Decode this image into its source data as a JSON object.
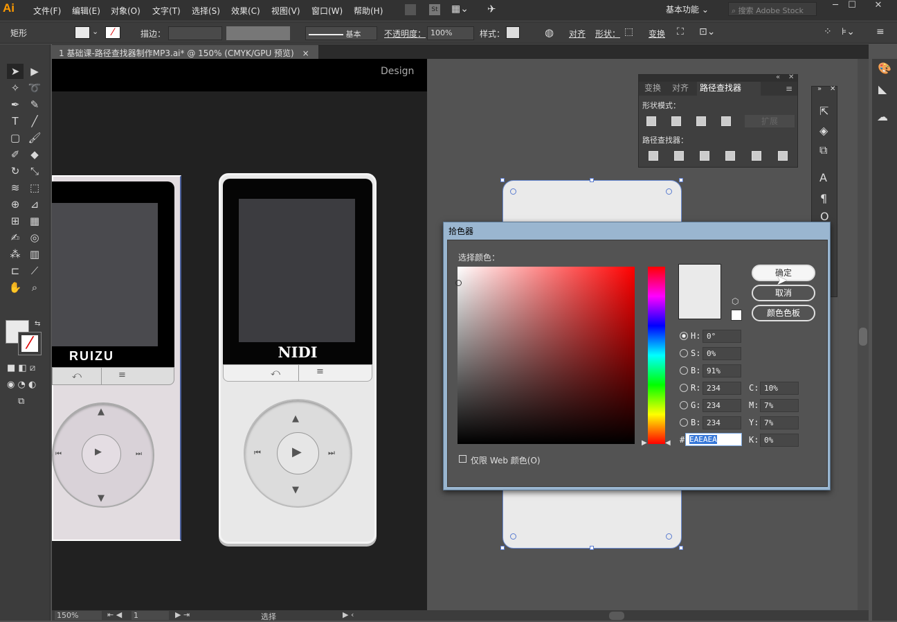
{
  "app": {
    "logo": "Ai",
    "workspace": "基本功能 ⌄",
    "stock_search": "搜索 Adobe Stock"
  },
  "menu": [
    "文件(F)",
    "编辑(E)",
    "对象(O)",
    "文字(T)",
    "选择(S)",
    "效果(C)",
    "视图(V)",
    "窗口(W)",
    "帮助(H)"
  ],
  "control": {
    "shape": "矩形",
    "stroke_label": "描边：",
    "style_preset": "基本",
    "opacity_label": "不透明度：",
    "opacity_value": "100%",
    "style_label": "样式：",
    "align": "对齐",
    "shape_label": "形状：",
    "transform": "变换"
  },
  "document": {
    "tab": "1 基础课-路径查找器制作MP3.ai* @ 150% (CMYK/GPU 预览)",
    "close": "×"
  },
  "artboard": {
    "design_text": "Design",
    "player1_brand": "RUIZU",
    "player2_brand": "NIDI"
  },
  "pathfinder": {
    "tabs": [
      "变换",
      "对齐",
      "路径查找器"
    ],
    "shape_modes": "形状模式：",
    "pathfinders": "路径查找器："
  },
  "status": {
    "zoom": "150%",
    "page": "1",
    "tool": "选择"
  },
  "color_picker": {
    "title": "拾色器",
    "select_color": "选择颜色：",
    "ok": "确定",
    "cancel": "取消",
    "swatches": "颜色色板",
    "h_label": "H:",
    "h": "0°",
    "s_label": "S:",
    "s": "0%",
    "b_label": "B:",
    "b": "91%",
    "r_label": "R:",
    "r": "234",
    "g_label": "G:",
    "g": "234",
    "b2_label": "B:",
    "b2": "234",
    "hex_label": "#",
    "hex": "EAEAEA",
    "c_label": "C:",
    "c": "10%",
    "m_label": "M:",
    "m": "7%",
    "y_label": "Y:",
    "y": "7%",
    "k_label": "K:",
    "k": "0%",
    "web_only": "仅限 Web 颜色(O)",
    "current_color": "#eaeaea"
  }
}
